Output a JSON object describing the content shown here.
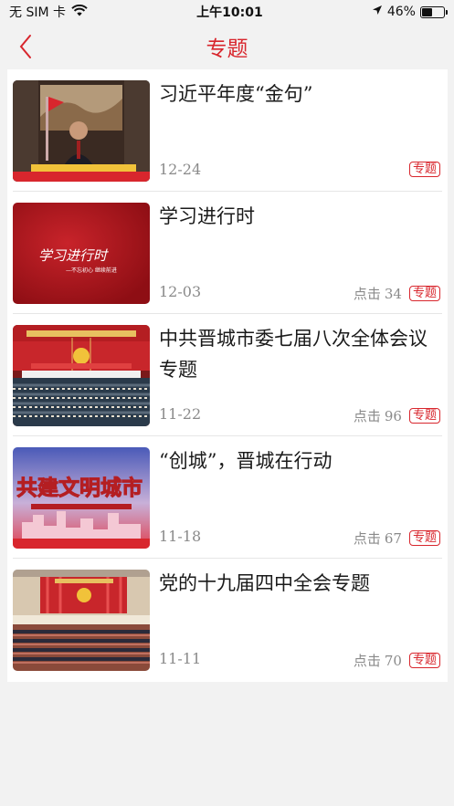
{
  "status_bar": {
    "carrier": "无 SIM 卡",
    "time": "上午10:01",
    "battery": "46%",
    "battery_level": 0.46
  },
  "nav": {
    "title": "专题",
    "back_icon": "chevron-left-icon"
  },
  "colors": {
    "accent": "#d8262d",
    "background": "#f2f2f2",
    "muted": "#8a8a8a"
  },
  "items": [
    {
      "title": "习近平年度“金句”",
      "date": "12-24",
      "views_label": "",
      "views": "",
      "badge": "专题"
    },
    {
      "title": "学习进行时",
      "date": "12-03",
      "views_label": "点击",
      "views": "34",
      "badge": "专题"
    },
    {
      "title": "中共晋城市委七届八次全体会议专题",
      "date": "11-22",
      "views_label": "点击",
      "views": "96",
      "badge": "专题"
    },
    {
      "title": "“创城”，晋城在行动",
      "date": "11-18",
      "views_label": "点击",
      "views": "67",
      "badge": "专题"
    },
    {
      "title": "党的十九届四中全会专题",
      "date": "11-11",
      "views_label": "点击",
      "views": "70",
      "badge": "专题"
    }
  ],
  "thumbnails": {
    "xuexi_text": "学习进行时",
    "xuexi_sub": "—不忘初心 继续前进",
    "chuangcheng_text": "共建文明城市"
  }
}
